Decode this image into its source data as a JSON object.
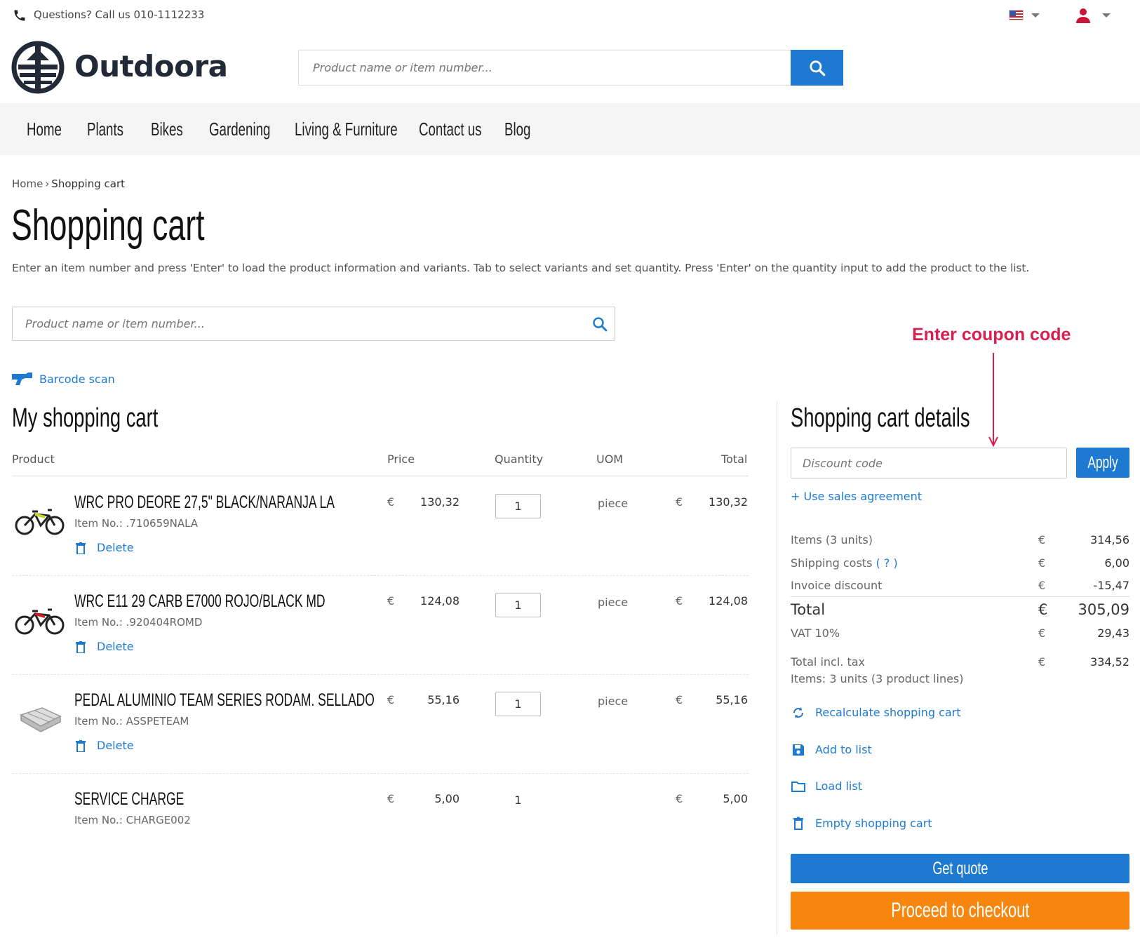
{
  "topbar": {
    "phone_text": "Questions? Call us 010-1112233"
  },
  "brand": {
    "name": "Outdoora",
    "color": "#222937"
  },
  "header": {
    "search_placeholder": "Product name or item number..."
  },
  "nav": {
    "items": [
      "Home",
      "Plants",
      "Bikes",
      "Gardening",
      "Living & Furniture",
      "Contact us",
      "Blog"
    ]
  },
  "breadcrumb": {
    "home": "Home",
    "separator": "›",
    "current": "Shopping cart"
  },
  "page": {
    "title": "Shopping cart",
    "intro": "Enter an item number and press 'Enter' to load the product information and variants. Tab to select variants and set quantity. Press 'Enter' on the quantity input to add the product to the list.",
    "quick_search_placeholder": "Product name or item number...",
    "barcode_label": "Barcode scan"
  },
  "annotation": {
    "text": "Enter coupon code",
    "color": "#d6204e"
  },
  "cart": {
    "title": "My shopping cart",
    "columns": {
      "product": "Product",
      "price": "Price",
      "quantity": "Quantity",
      "uom": "UOM",
      "total": "Total"
    },
    "currency": "€",
    "delete_label": "Delete",
    "items": [
      {
        "name": "WRC PRO DEORE 27,5\" BLACK/NARANJA LA",
        "item_no": "Item No.: .710659NALA",
        "price": "130,32",
        "qty": "1",
        "uom": "piece",
        "total": "130,32"
      },
      {
        "name": "WRC E11 29 CARB E7000 ROJO/BLACK MD",
        "item_no": "Item No.: .920404ROMD",
        "price": "124,08",
        "qty": "1",
        "uom": "piece",
        "total": "124,08"
      },
      {
        "name": "PEDAL ALUMINIO TEAM SERIES RODAM. SELLADO",
        "item_no": "Item No.: ASSPETEAM",
        "price": "55,16",
        "qty": "1",
        "uom": "piece",
        "total": "55,16"
      },
      {
        "name": "SERVICE CHARGE",
        "item_no": "Item No.: CHARGE002",
        "price": "5,00",
        "qty": "1",
        "uom": "",
        "total": "5,00"
      }
    ]
  },
  "details": {
    "title": "Shopping cart details",
    "discount_placeholder": "Discount code",
    "apply_label": "Apply",
    "sales_agreement": "+ Use sales agreement",
    "summary": {
      "items_label": "Items (3 units)",
      "items_value": "314,56",
      "shipping_label": "Shipping costs",
      "shipping_help": "( ? )",
      "shipping_value": "6,00",
      "invoice_discount_label": "Invoice discount",
      "invoice_discount_value": "-15,47",
      "total_label": "Total",
      "total_value": "305,09",
      "vat_label": "VAT 10%",
      "vat_value": "29,43",
      "total_incl_label": "Total incl. tax",
      "total_incl_value": "334,52",
      "items_note": "Items: 3 units (3 product lines)"
    },
    "actions": {
      "recalculate": "Recalculate shopping cart",
      "add_to_list": "Add to list",
      "load_list": "Load list",
      "empty_cart": "Empty shopping cart"
    },
    "get_quote": "Get quote",
    "checkout": "Proceed to checkout"
  },
  "colors": {
    "primary": "#1d7ad0",
    "checkout": "#f7860e",
    "nav_bg": "#f5f5f5"
  }
}
